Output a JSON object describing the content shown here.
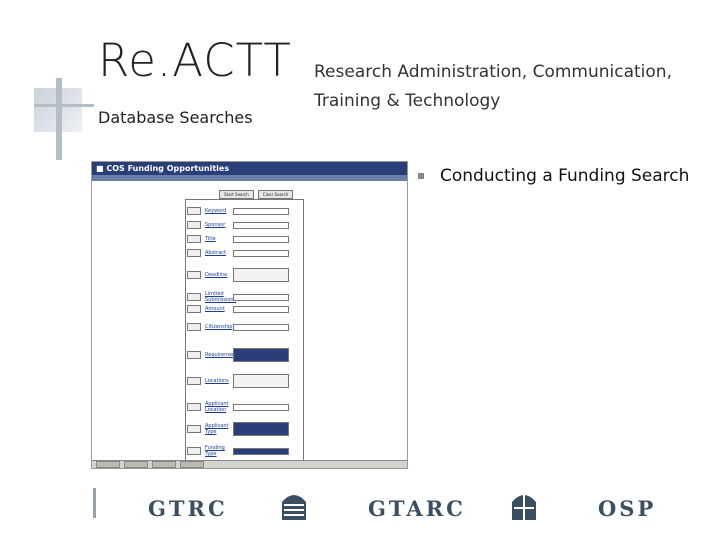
{
  "header": {
    "brand": "Re.ACTT",
    "subtitle": "Database Searches",
    "org_line1": "Research Administration, Communication,",
    "org_line2": "Training & Technology"
  },
  "bullets": [
    "Conducting a Funding Search"
  ],
  "screenshot": {
    "titlebar": "■ COS Funding Opportunities",
    "top_buttons": [
      "Start Search",
      "Clear Search"
    ],
    "form_fields": [
      "Keyword",
      "Sponsor",
      "Title",
      "Abstract",
      "Deadline",
      "Limited Submissions",
      "Amount",
      "Citizenship",
      "Requirements",
      "Locations",
      "Applicant Location",
      "Applicant Type",
      "Funding Type"
    ]
  },
  "footer": {
    "logos": [
      "GTRC",
      "GTARC",
      "OSP"
    ]
  },
  "colors": {
    "logo_text": "#3b4f63",
    "shot_titlebar": "#2a3f7a",
    "accent_grey": "#b5bdc6"
  }
}
